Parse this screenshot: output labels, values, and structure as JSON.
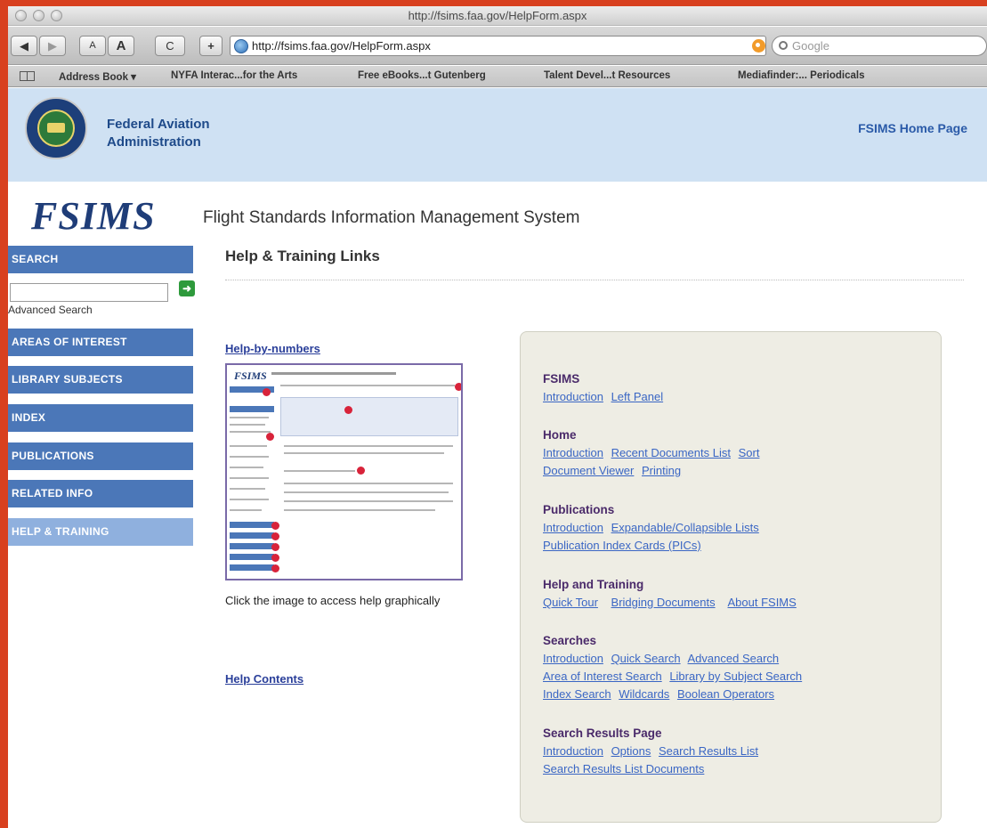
{
  "browser": {
    "window_title": "http://fsims.faa.gov/HelpForm.aspx",
    "url": "http://fsims.faa.gov/HelpForm.aspx",
    "search_placeholder": "Google",
    "back_label": "◀",
    "forward_label": "▶",
    "text_smaller": "A",
    "text_larger": "A",
    "reload_label": "C",
    "add_label": "+",
    "bookmarks": [
      "Address Book ▾",
      "NYFA Interac...for the Arts",
      "Free eBooks...t Gutenberg",
      "Talent Devel...t Resources",
      "Mediafinder:... Periodicals"
    ]
  },
  "header": {
    "agency_name": "Federal Aviation Administration",
    "home_link": "FSIMS Home Page"
  },
  "site": {
    "logo": "FSIMS",
    "title": "Flight Standards Information Management System"
  },
  "sidebar": {
    "search_label": "SEARCH",
    "go_label": "➜",
    "advanced_search": "Advanced Search",
    "items": [
      {
        "label": "AREAS OF INTEREST"
      },
      {
        "label": "LIBRARY SUBJECTS"
      },
      {
        "label": "INDEX"
      },
      {
        "label": "PUBLICATIONS"
      },
      {
        "label": "RELATED INFO"
      },
      {
        "label": "HELP & TRAINING"
      }
    ]
  },
  "main": {
    "page_title": "Help & Training Links",
    "help_by_numbers": "Help-by-numbers",
    "thumbnail_logo": "FSIMS",
    "thumbnail_caption": "Click the image to access help graphically",
    "help_contents": "Help Contents"
  },
  "panel": {
    "sections": [
      {
        "title": "FSIMS",
        "lines": [
          [
            "Introduction",
            "Left Panel"
          ]
        ]
      },
      {
        "title": "Home",
        "lines": [
          [
            "Introduction",
            "Recent Documents List",
            "Sort"
          ],
          [
            "Document Viewer",
            "Printing"
          ]
        ]
      },
      {
        "title": "Publications",
        "lines": [
          [
            "Introduction",
            "Expandable/Collapsible Lists"
          ],
          [
            "Publication Index Cards (PICs)"
          ]
        ]
      },
      {
        "title": "Help and Training",
        "lines": [
          [
            "Quick Tour",
            "Bridging Documents",
            "About FSIMS"
          ]
        ]
      },
      {
        "title": "Searches",
        "lines": [
          [
            "Introduction",
            "Quick Search",
            "Advanced Search"
          ],
          [
            "Area of Interest Search",
            "Library by Subject Search"
          ],
          [
            "Index Search",
            "Wildcards",
            "Boolean Operators"
          ]
        ]
      },
      {
        "title": "Search Results Page",
        "lines": [
          [
            "Introduction",
            "Options",
            "Search Results List"
          ],
          [
            "Search Results List Documents"
          ]
        ]
      }
    ]
  }
}
